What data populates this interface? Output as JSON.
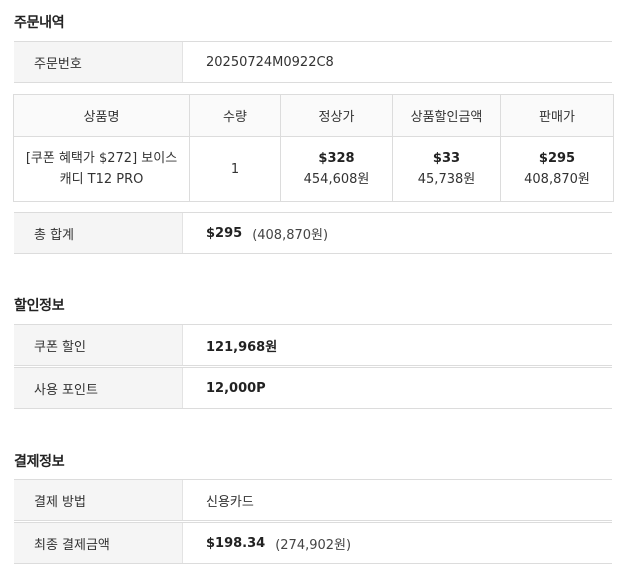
{
  "order": {
    "title": "주문내역",
    "number_label": "주문번호",
    "number_value": "20250724M0922C8",
    "table": {
      "headers": [
        "상품명",
        "수량",
        "정상가",
        "상품할인금액",
        "판매가"
      ],
      "row": {
        "name": "[쿠폰 혜택가 $272] 보이스 캐디 T12 PRO",
        "qty": "1",
        "regular_usd": "$328",
        "regular_krw": "454,608원",
        "discount_usd": "$33",
        "discount_krw": "45,738원",
        "sale_usd": "$295",
        "sale_krw": "408,870원"
      }
    },
    "total_label": "총 합계",
    "total_usd": "$295",
    "total_krw": "(408,870원)"
  },
  "discount": {
    "title": "할인정보",
    "coupon_label": "쿠폰 할인",
    "coupon_value": "121,968원",
    "points_label": "사용 포인트",
    "points_value": "12,000P"
  },
  "payment": {
    "title": "결제정보",
    "method_label": "결제 방법",
    "method_value": "신용카드",
    "final_label": "최종 결제금액",
    "final_usd": "$198.34",
    "final_krw": "(274,902원)"
  }
}
